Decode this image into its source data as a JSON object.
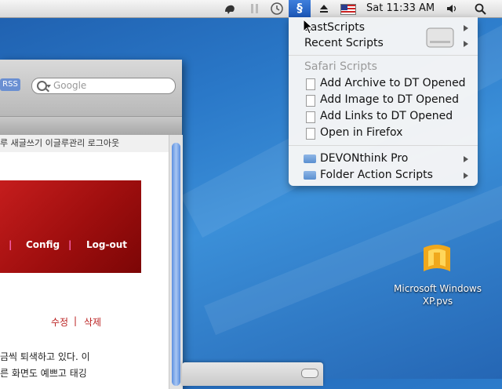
{
  "menubar": {
    "clock": "Sat 11:33 AM"
  },
  "script_menu": {
    "top_items": [
      {
        "label": "LastScripts",
        "submenu": true
      },
      {
        "label": "Recent Scripts",
        "submenu": true
      }
    ],
    "section_title": "Safari Scripts",
    "safari_scripts": [
      "Add Archive to DT Opened",
      "Add Image to DT Opened",
      "Add Links to DT Opened",
      "Open in Firefox"
    ],
    "folders": [
      {
        "label": "DEVONthink Pro",
        "submenu": true
      },
      {
        "label": "Folder Action Scripts",
        "submenu": true
      }
    ]
  },
  "browser": {
    "rss_label": "RSS",
    "search_placeholder": "Google",
    "link_bar_text": "루  새글쓰기  이글루관리  로그아웃",
    "banner_nav": [
      "Config",
      "Log-out"
    ],
    "edit_label": "수정",
    "delete_label": "삭제",
    "body_lines": [
      "금씩 퇴색하고 있다. 이",
      "른 화면도 예쁘고 태깅"
    ]
  },
  "desktop": {
    "xp_icon_label_line1": "Microsoft Windows",
    "xp_icon_label_line2": "XP.pvs"
  },
  "colors": {
    "menu_highlight": "#2a64c8",
    "desktop_blue": "#2a78c8",
    "banner_red": "#c51d1d"
  }
}
